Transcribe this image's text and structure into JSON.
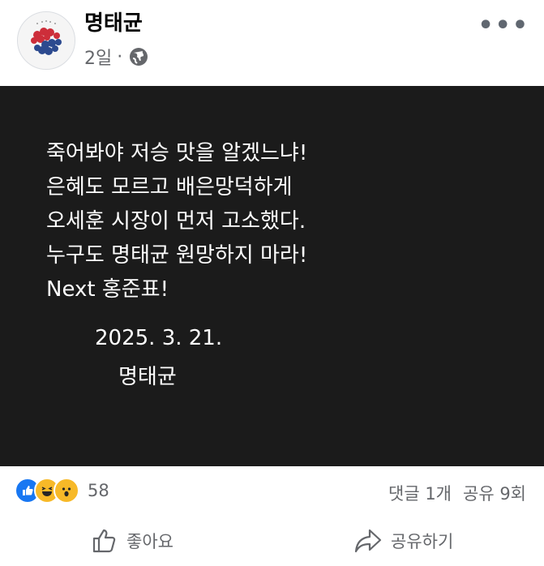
{
  "author": {
    "name": "명태균",
    "time": "2일",
    "privacy_icon": "globe-icon"
  },
  "menu": {
    "icon": "more-icon"
  },
  "post": {
    "lines": [
      "죽어봐야 저승 맛을 알겠느냐!",
      "은혜도 모르고 배은망덕하게",
      "오세훈 시장이 먼저 고소했다.",
      "누구도 명태균 원망하지 마라!",
      "Next 홍준표!"
    ],
    "date": "2025. 3. 21.",
    "signature": "명태균",
    "background": "#1b1b1b"
  },
  "reactions": {
    "types": [
      "like",
      "haha",
      "wow"
    ],
    "count": "58"
  },
  "engagement": {
    "comments": "댓글 1개",
    "shares": "공유 9회"
  },
  "actions": {
    "like_label": "좋아요",
    "share_label": "공유하기"
  },
  "colors": {
    "accent": "#1877f2",
    "muted": "#65676b"
  }
}
